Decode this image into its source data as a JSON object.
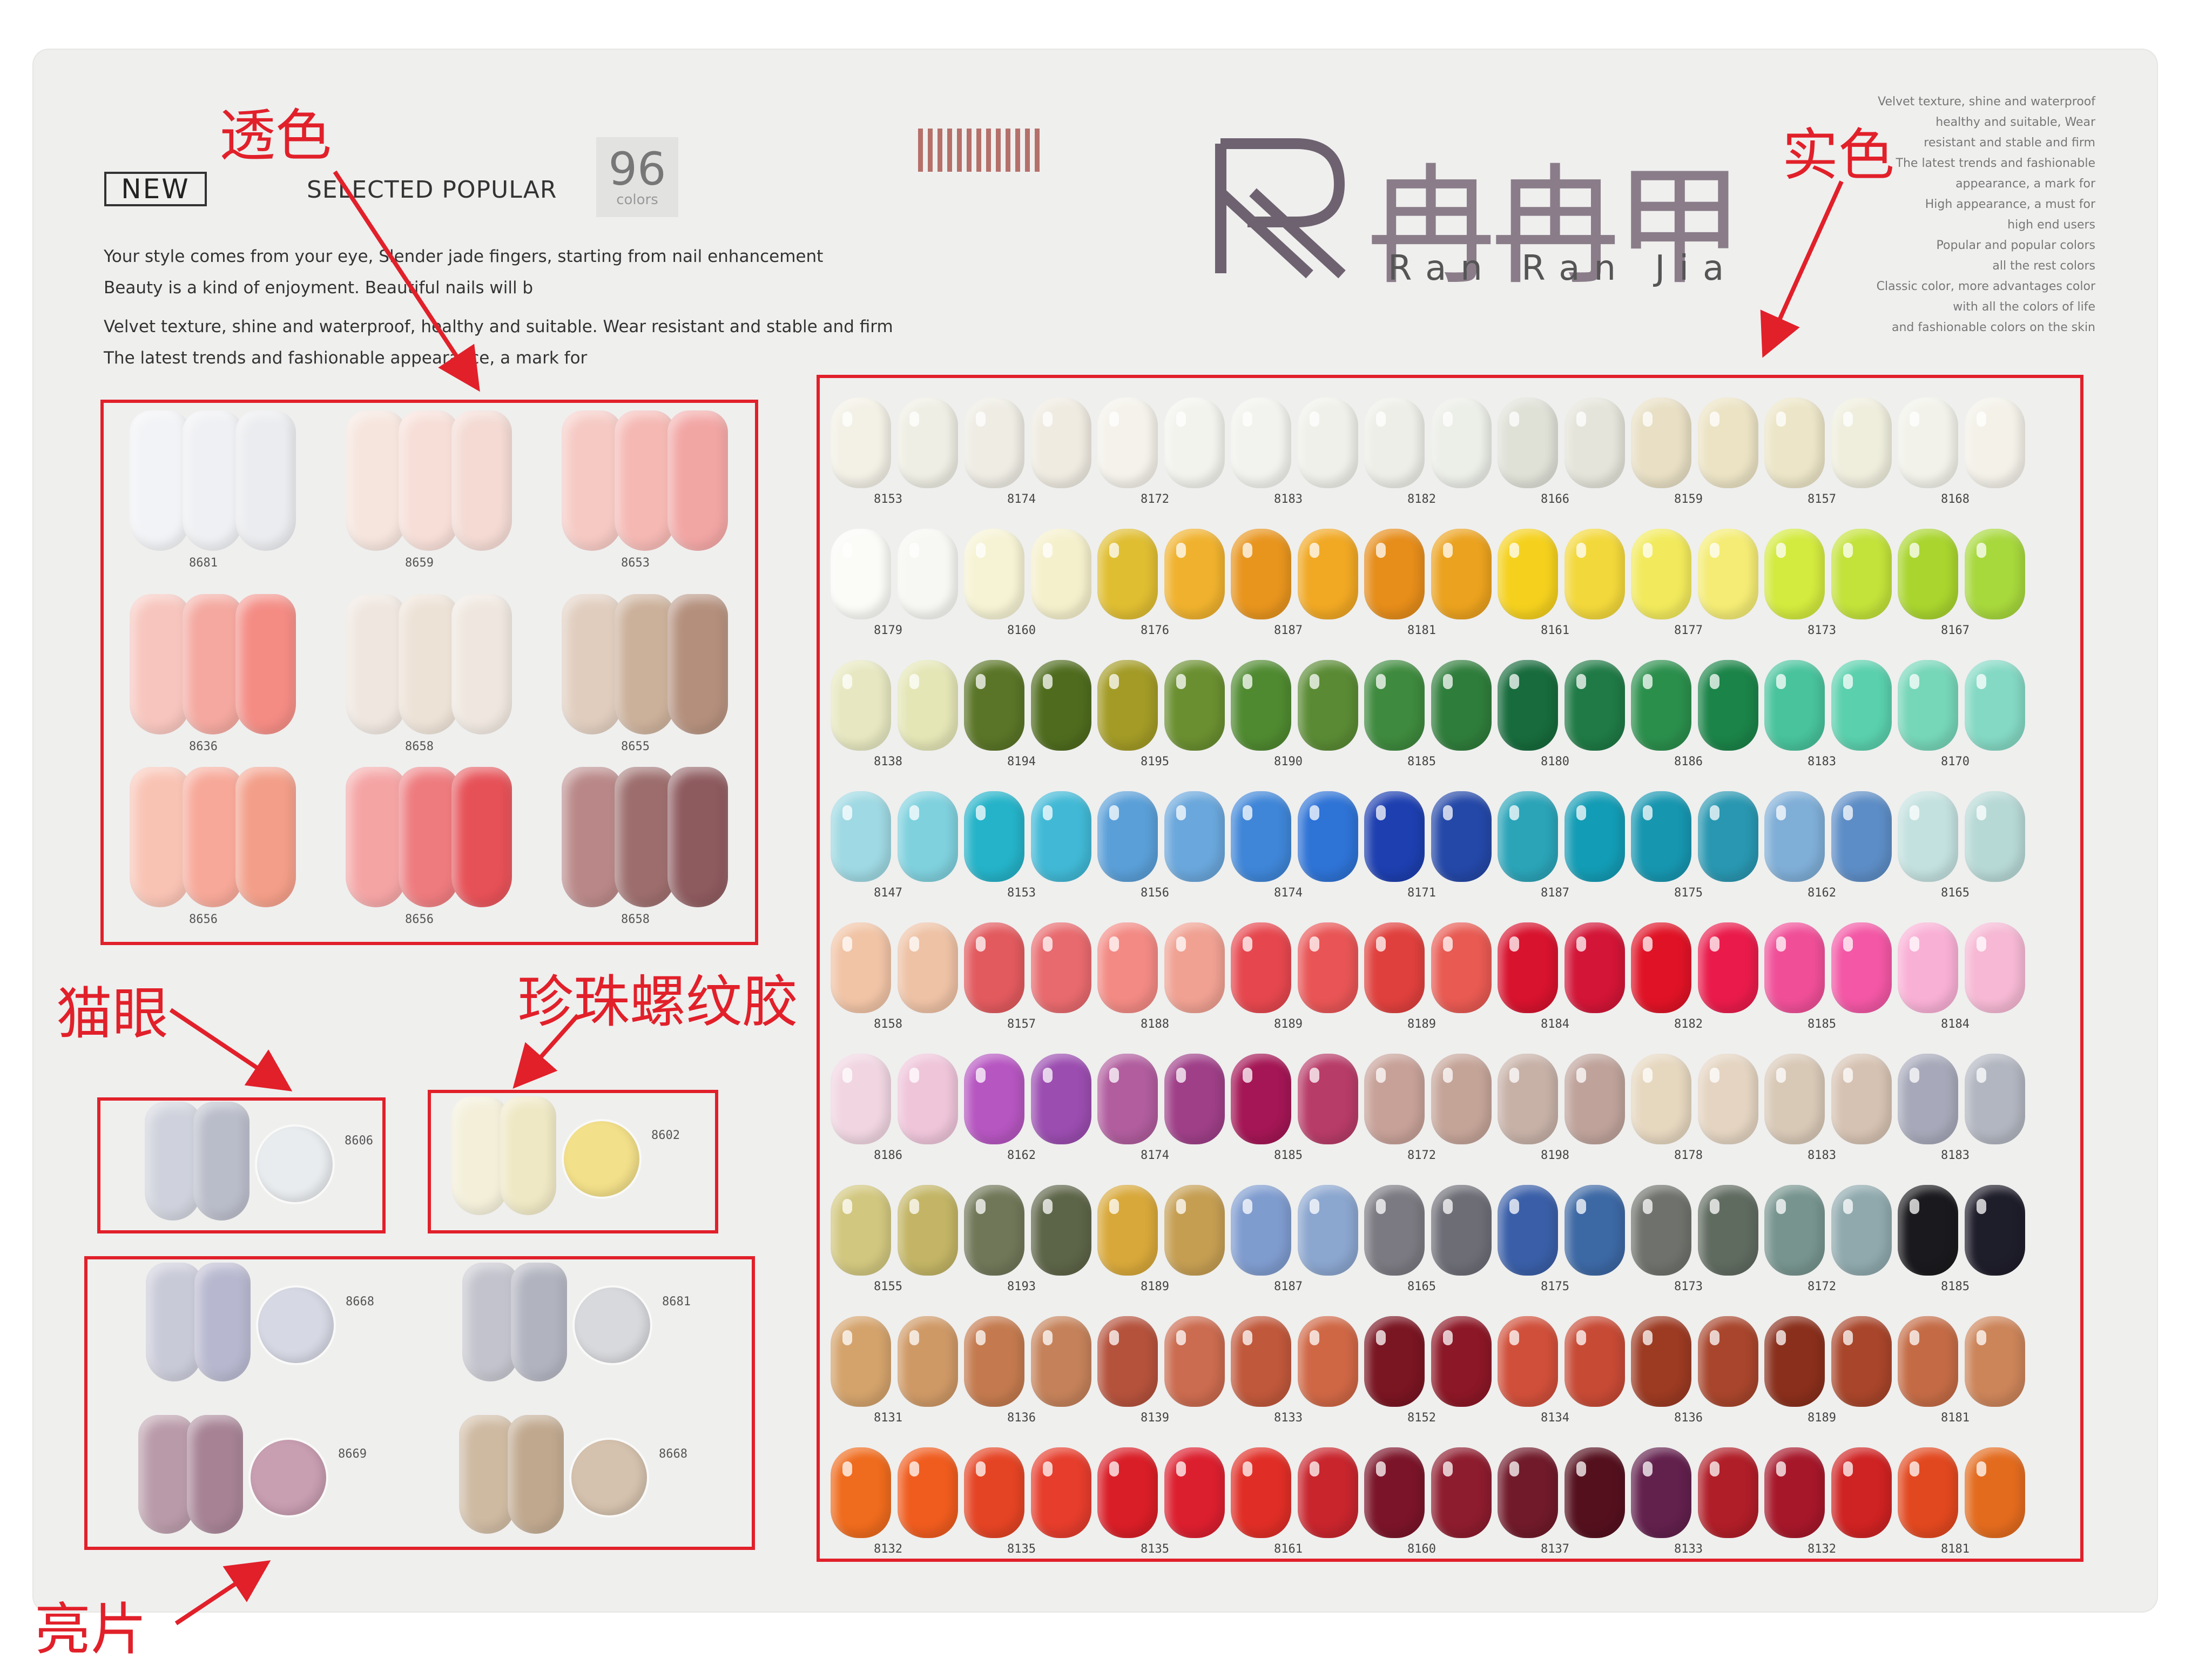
{
  "header": {
    "new_badge": "NEW",
    "selected_popular": "SELECTED POPULAR",
    "colors_count": "96",
    "colors_label": "colors",
    "slogan_lines": [
      "Your style comes from your eye, Slender jade fingers, starting from nail enhancement",
      "Beauty is a kind of enjoyment. Beautiful nails will b",
      "Velvet texture, shine and waterproof, healthy and suitable. Wear resistant and stable and firm",
      "The latest trends and fashionable appearance, a mark for"
    ]
  },
  "brand": {
    "name_cn": "冉冉甲",
    "name_en": "Ran Ran Jia",
    "logo_letter": "R"
  },
  "annotations": {
    "translucent": "透色",
    "solid": "实色",
    "cat_eye": "猫眼",
    "pearl": "珍珠螺纹胶",
    "glitter": "亮片"
  },
  "accent_color": "#e1202a",
  "solid_rows": [
    {
      "colors": [
        "#f3f1e6",
        "#efeee4",
        "#eeece3",
        "#efebe1",
        "#f4f2ea",
        "#f3f3ee",
        "#f2f2ee",
        "#f0f0ea",
        "#eeeee8",
        "#eceee8",
        "#dfe1d7",
        "#e4e4da",
        "#e8dfc4",
        "#ece3c4",
        "#ece5c7",
        "#efeedd",
        "#f2f2ea",
        "#f3f1e8"
      ],
      "codes": [
        "8153",
        "",
        "8174",
        "",
        "8172",
        "",
        "8183",
        "",
        "8182",
        "",
        "8166",
        "",
        "8159",
        "",
        "8157",
        "",
        "8168",
        ""
      ]
    },
    {
      "colors": [
        "#fbfbf8",
        "#f7f7f3",
        "#f6f3d4",
        "#f5f0cc",
        "#e0be32",
        "#f0b22e",
        "#e8951e",
        "#f1a823",
        "#e68d1a",
        "#eba21e",
        "#f5d11e",
        "#f3d83b",
        "#f2ea5c",
        "#f4ec74",
        "#d3ea3e",
        "#c3e23a",
        "#a9d52e",
        "#a7d83c"
      ],
      "codes": [
        "8179",
        "",
        "8160",
        "",
        "8176",
        "",
        "8187",
        "",
        "8181",
        "",
        "8161",
        "",
        "8177",
        "",
        "8173",
        "",
        "8167",
        ""
      ]
    },
    {
      "colors": [
        "#e7e8c1",
        "#e4e6b6",
        "#5a7527",
        "#4f6c1e",
        "#a39b26",
        "#6a8f30",
        "#4f8a30",
        "#5a8b34",
        "#3e8a3e",
        "#2f7d3b",
        "#176b3c",
        "#1f7a45",
        "#2b8f4c",
        "#1b8448",
        "#48c39c",
        "#5ad0ac",
        "#76d6b8",
        "#84d9c4"
      ],
      "codes": [
        "8138",
        "",
        "8194",
        "",
        "8195",
        "",
        "8190",
        "",
        "8185",
        "",
        "8180",
        "",
        "8186",
        "",
        "8183",
        "",
        "8170",
        ""
      ]
    },
    {
      "colors": [
        "#9fd9e3",
        "#7fd1de",
        "#25b3c9",
        "#41b9d6",
        "#5a9fd8",
        "#6aa7dc",
        "#3f86d8",
        "#2e73d6",
        "#1d3fb0",
        "#2448a8",
        "#2ba4b8",
        "#139cb5",
        "#1796b0",
        "#2997b1",
        "#7faed7",
        "#5d8dc6",
        "#c3e1df",
        "#b7d9d6"
      ],
      "codes": [
        "8147",
        "",
        "8153",
        "",
        "8156",
        "",
        "8174",
        "",
        "8171",
        "",
        "8187",
        "",
        "8175",
        "",
        "8162",
        "",
        "8165",
        ""
      ]
    },
    {
      "colors": [
        "#f1c4a6",
        "#eec2a5",
        "#e25a5e",
        "#e86a6e",
        "#f38a84",
        "#f0a192",
        "#e6474e",
        "#e95556",
        "#e0403d",
        "#e85a52",
        "#d8132e",
        "#d31537",
        "#e01326",
        "#ea1b4b",
        "#f04f98",
        "#f357a5",
        "#f9b0d5",
        "#f6b8d4"
      ],
      "codes": [
        "8158",
        "",
        "8157",
        "",
        "8188",
        "",
        "8189",
        "",
        "8189",
        "",
        "8184",
        "",
        "8182",
        "",
        "8185",
        "",
        "8184",
        ""
      ]
    },
    {
      "colors": [
        "#f1d6e2",
        "#efc5da",
        "#b656c1",
        "#9b4db0",
        "#b15d9e",
        "#9f3f88",
        "#a41655",
        "#b83c68",
        "#c7a198",
        "#c5a498",
        "#c7b1a7",
        "#bfa39b",
        "#e6d7bf",
        "#e4d4c1",
        "#d8c8b6",
        "#d6c2b2",
        "#a7a9ba",
        "#b2b6c0"
      ],
      "codes": [
        "8186",
        "",
        "8162",
        "",
        "8174",
        "",
        "8185",
        "",
        "8172",
        "",
        "8198",
        "",
        "8178",
        "",
        "8183",
        "",
        "8183",
        ""
      ]
    },
    {
      "colors": [
        "#d2c77f",
        "#c3b565",
        "#707758",
        "#5d6548",
        "#d8a83a",
        "#c59e52",
        "#7f9ccf",
        "#8ba6cf",
        "#7b7a82",
        "#6d6d76",
        "#3a5fa8",
        "#3c68a4",
        "#6f726c",
        "#606b60",
        "#77948e",
        "#8fa9ad",
        "#1a1a1e",
        "#1e1d2a"
      ],
      "codes": [
        "8155",
        "",
        "8193",
        "",
        "8189",
        "",
        "8187",
        "",
        "8165",
        "",
        "8175",
        "",
        "8173",
        "",
        "8172",
        "",
        "8185",
        ""
      ]
    },
    {
      "colors": [
        "#d4a36c",
        "#cf9966",
        "#c47a4e",
        "#c5825a",
        "#b5523c",
        "#cb6b4f",
        "#c0583b",
        "#cf6745",
        "#7a1522",
        "#8c1726",
        "#d04f3a",
        "#c74a35",
        "#9c3a22",
        "#a8452c",
        "#8a2f1c",
        "#a8452a",
        "#c46b45",
        "#cc8459"
      ],
      "codes": [
        "8131",
        "",
        "8136",
        "",
        "8139",
        "",
        "8133",
        "",
        "8152",
        "",
        "8134",
        "",
        "8136",
        "",
        "8189",
        "",
        "8181",
        ""
      ]
    },
    {
      "colors": [
        "#ef6b1d",
        "#f05c1e",
        "#e54424",
        "#e63d2c",
        "#d91e27",
        "#dc1f2f",
        "#e02e26",
        "#c8252d",
        "#7b1429",
        "#8d1c2e",
        "#701a2a",
        "#55101e",
        "#62204d",
        "#b01e28",
        "#a6172a",
        "#cf2222",
        "#e2481f",
        "#e36b1e"
      ],
      "codes": [
        "8132",
        "",
        "8135",
        "",
        "8135",
        "",
        "8161",
        "",
        "8160",
        "",
        "8137",
        "",
        "8133",
        "",
        "8132",
        "",
        "8181",
        ""
      ]
    }
  ],
  "translucent_groups": [
    {
      "code": "8681",
      "colors": [
        "#f2f3f6",
        "#eff0f3",
        "#ebecef"
      ]
    },
    {
      "code": "8659",
      "colors": [
        "#f6e5dd",
        "#f7ded7",
        "#f4dad3"
      ]
    },
    {
      "code": "8653",
      "colors": [
        "#f6c9c3",
        "#f5b8b3",
        "#f2a6a4"
      ]
    },
    {
      "code": "8636",
      "colors": [
        "#f7c5bd",
        "#f4a89f",
        "#f48c84"
      ]
    },
    {
      "code": "8658",
      "colors": [
        "#efe6df",
        "#ede2d6",
        "#efe7df"
      ]
    },
    {
      "code": "8655",
      "colors": [
        "#e0cdbe",
        "#cbb09a",
        "#b48f7c"
      ]
    },
    {
      "code": "8656",
      "colors": [
        "#f9c3b4",
        "#f7a898",
        "#f39e88"
      ]
    },
    {
      "code": "8656",
      "colors": [
        "#f5a4a4",
        "#ee7b7e",
        "#e65157"
      ]
    },
    {
      "code": "8658",
      "colors": [
        "#b98787",
        "#9c6d6c",
        "#8d5a5e"
      ]
    }
  ],
  "cat_eye": {
    "code": "8606",
    "colors": [
      "#cfd2dc",
      "#b9bcc9"
    ],
    "circle": "#e9ecef"
  },
  "pearl": {
    "code": "8602",
    "colors": [
      "#f3efd9",
      "#efe8c4"
    ],
    "circle": "#f3e08a"
  },
  "glitter_groups": [
    {
      "code": "8668",
      "colors": [
        "#c9cad8",
        "#b7b7cf"
      ],
      "circle": "#d6d8e4"
    },
    {
      "code": "8681",
      "colors": [
        "#c3c3cd",
        "#b1b3bf"
      ],
      "circle": "#d8d9dd"
    },
    {
      "code": "8669",
      "colors": [
        "#b99aa8",
        "#a68294"
      ],
      "circle": "#c89eb1"
    },
    {
      "code": "8668",
      "colors": [
        "#ceb9a1",
        "#c0a88e"
      ],
      "circle": "#d5c2ae"
    }
  ],
  "right_copy": [
    "Velvet texture, shine and waterproof",
    "healthy and suitable, Wear",
    "resistant and stable and firm",
    "The latest trends and fashionable",
    "appearance, a mark for",
    "High appearance, a must for",
    "high end users",
    "Popular and popular colors",
    "all the rest colors",
    "Classic color, more advantages color",
    "with all the colors of life",
    "and fashionable colors on the skin"
  ]
}
